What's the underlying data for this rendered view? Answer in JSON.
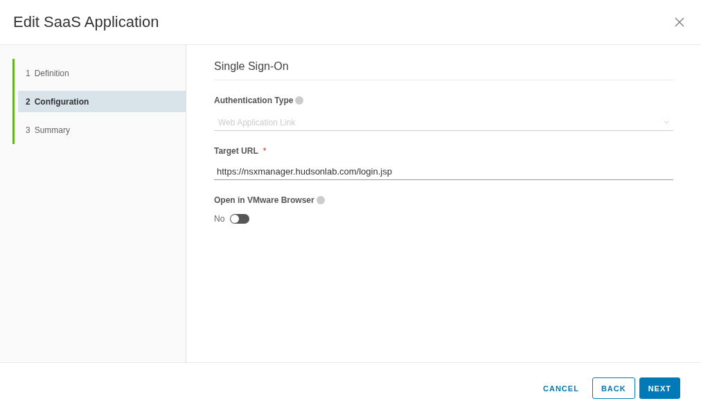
{
  "dialog": {
    "title": "Edit SaaS Application"
  },
  "steps": [
    {
      "number": "1",
      "label": "Definition",
      "selected": false
    },
    {
      "number": "2",
      "label": "Configuration",
      "selected": true
    },
    {
      "number": "3",
      "label": "Summary",
      "selected": false
    }
  ],
  "section": {
    "title": "Single Sign-On"
  },
  "fields": [
    {
      "kind": "select",
      "label": "Authentication Type",
      "info": true,
      "value": "Web Application Link",
      "disabled": true
    },
    {
      "kind": "text",
      "label": "Target URL",
      "info": false,
      "required_mark": "*",
      "value": "https://nsxmanager.hudsonlab.com/login.jsp",
      "disabled": false
    },
    {
      "kind": "toggle",
      "label": "Open in VMware Browser",
      "info": true,
      "value": "No",
      "on": false
    }
  ],
  "buttons": [
    {
      "kind": "link",
      "label": "CANCEL"
    },
    {
      "kind": "outline",
      "label": "BACK"
    },
    {
      "kind": "primary",
      "label": "NEXT"
    }
  ]
}
